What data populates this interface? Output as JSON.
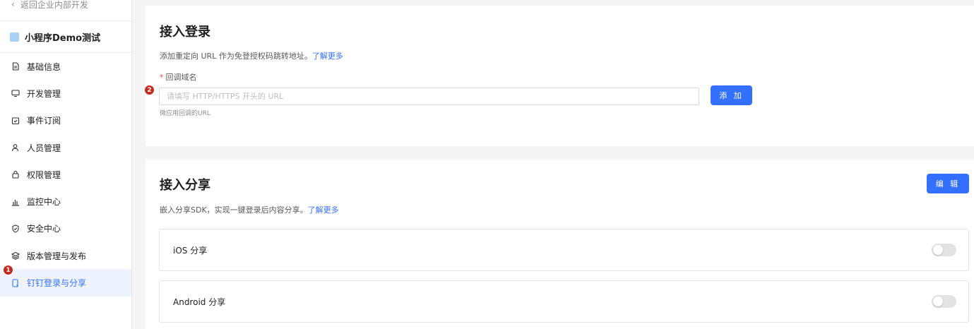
{
  "sidebar": {
    "back_label": "返回企业内部开发",
    "app_name": "小程序Demo测试",
    "items": [
      {
        "label": "基础信息",
        "icon": "document-icon"
      },
      {
        "label": "开发管理",
        "icon": "monitor-icon"
      },
      {
        "label": "事件订阅",
        "icon": "calendar-check-icon"
      },
      {
        "label": "人员管理",
        "icon": "person-icon"
      },
      {
        "label": "权限管理",
        "icon": "lock-icon"
      },
      {
        "label": "监控中心",
        "icon": "bar-chart-icon"
      },
      {
        "label": "安全中心",
        "icon": "shield-check-icon"
      },
      {
        "label": "版本管理与发布",
        "icon": "layers-icon"
      },
      {
        "label": "钉钉登录与分享",
        "icon": "phone-share-icon",
        "active": true
      }
    ],
    "step_badge": "1"
  },
  "login": {
    "title": "接入登录",
    "desc": "添加重定向 URL 作为免登授权码跳转地址。",
    "learn_more": "了解更多",
    "required_mark": "*",
    "field_label": "回调域名",
    "input_placeholder": "请填写 HTTP/HTTPS 开头的 URL",
    "input_value": "",
    "hint": "微应用回调的URL",
    "add_button": "添 加",
    "step_badge": "2"
  },
  "share": {
    "title": "接入分享",
    "desc": "嵌入分享SDK，实现一键登录后内容分享。",
    "learn_more": "了解更多",
    "edit_button": "编 辑",
    "rows": [
      {
        "label": "iOS 分享",
        "enabled": false
      },
      {
        "label": "Android 分享",
        "enabled": false
      }
    ]
  },
  "colors": {
    "accent": "#3370ff",
    "badge": "#c42b1c",
    "active_bg": "#eef3ff"
  }
}
